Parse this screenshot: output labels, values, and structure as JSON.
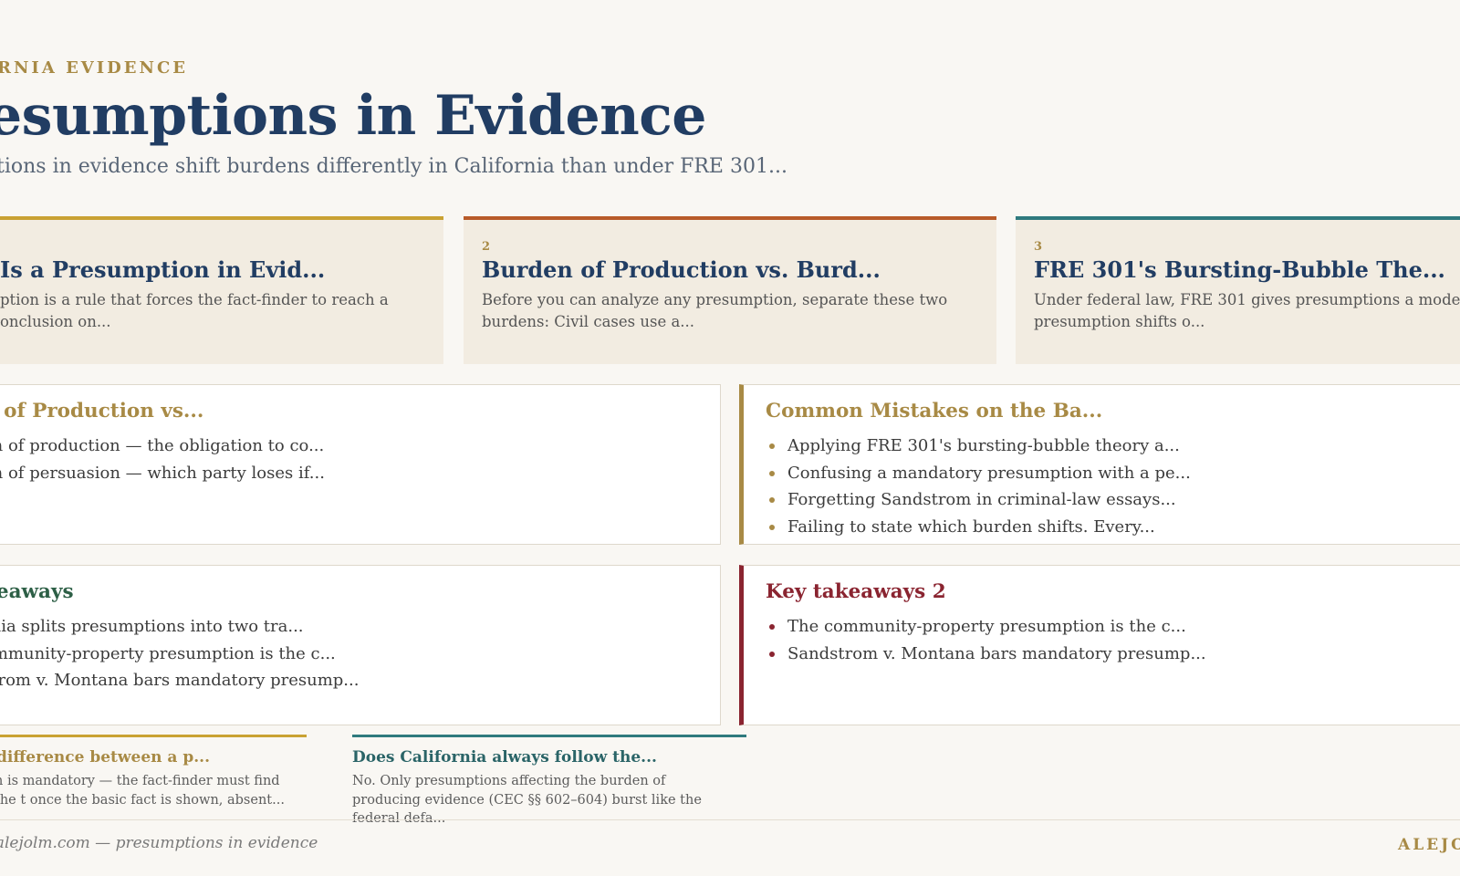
{
  "header": {
    "eyebrow": "RNIA EVIDENCE",
    "title": "esumptions in Evidence",
    "subtitle": "tions in evidence shift burdens differently in California than under FRE 301..."
  },
  "cards": [
    {
      "number": "",
      "title": "Is a Presumption in Evid...",
      "desc": "ption is a rule that forces the fact-finder to reach a onclusion on..."
    },
    {
      "number": "2",
      "title": "Burden of Production vs. Burd...",
      "desc": "Before you can analyze any presumption, separate these two burdens: Civil cases use a..."
    },
    {
      "number": "3",
      "title": "FRE 301's Bursting-Bubble The...",
      "desc": "Under federal law, FRE 301 gives presumptions a modest presumption shifts o..."
    }
  ],
  "panels": {
    "production": {
      "title": "n of Production vs...",
      "items": [
        "en of production — the obligation to co...",
        "en of persuasion — which party loses if..."
      ]
    },
    "mistakes": {
      "title": "Common Mistakes on the Ba...",
      "items": [
        "Applying FRE 301's bursting-bubble theory a...",
        "Confusing a mandatory presumption with a pe...",
        "Forgetting Sandstrom in criminal-law essays...",
        "Failing to state which burden shifts. Every..."
      ]
    },
    "takeaways": {
      "title": "keaways",
      "items": [
        "rnia splits presumptions into two tra...",
        "ommunity-property presumption is the c...",
        "strom v. Montana bars mandatory presump..."
      ]
    },
    "takeaways2": {
      "title": "Key takeaways 2",
      "items": [
        "The community-property presumption is the c...",
        "Sandstrom v. Montana bars mandatory presump..."
      ]
    }
  },
  "faq": [
    {
      "question": "difference between a p...",
      "answer": "n is mandatory — the fact-finder must find the t once the basic fact is shown, absent..."
    },
    {
      "question": "Does California always follow the...",
      "answer": "No. Only presumptions affecting the burden of producing evidence (CEC §§ 602–604) burst like the federal defa..."
    }
  ],
  "footer": {
    "left": "· alejolm.com — presumptions in evidence",
    "right": "ALEJO"
  }
}
